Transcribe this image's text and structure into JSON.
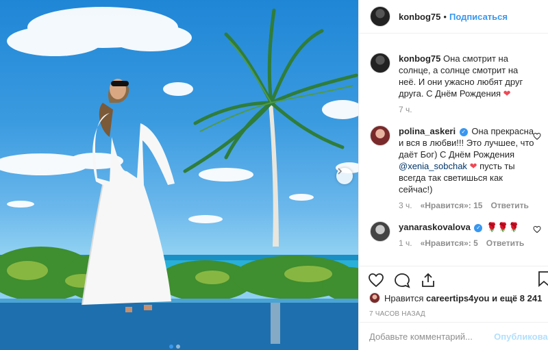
{
  "post": {
    "author": "konbog75",
    "follow_label": "Подписаться",
    "separator": "•"
  },
  "comments": [
    {
      "username": "konbog75",
      "text": "Она смотрит на солнце, а солнце смотрит на неё. И они ужасно любят друг друга. С Днём Рождения",
      "time": "7 ч."
    },
    {
      "username": "polina_askeri",
      "text_part1": "Она прекрасна и вся в любви!!! Это лучшее, что даёт Бог) С Днём Рождения",
      "mention": "@xenia_sobchak",
      "text_part2": "пусть ты всегда так светишься как сейчас!)",
      "time": "3 ч.",
      "likes": "«Нравится»: 15",
      "reply": "Ответить"
    },
    {
      "username": "yanaraskovalova",
      "time": "1 ч.",
      "likes": "«Нравится»: 5",
      "reply": "Ответить"
    }
  ],
  "likes": {
    "prefix": "Нравится",
    "user": "careertips4you",
    "suffix": "и ещё 8 241"
  },
  "timestamp": "7 ЧАСОВ НАЗАД",
  "add_comment": {
    "placeholder": "Добавьте комментарий...",
    "publish": "Опубликовать"
  },
  "icons": {
    "heart": "heart-icon",
    "comment": "comment-icon",
    "share": "share-icon",
    "bookmark": "bookmark-icon",
    "next": "chevron-right-icon"
  },
  "colors": {
    "accent": "#3897f0",
    "heart": "#ed4956",
    "muted": "#8e8e8e"
  }
}
